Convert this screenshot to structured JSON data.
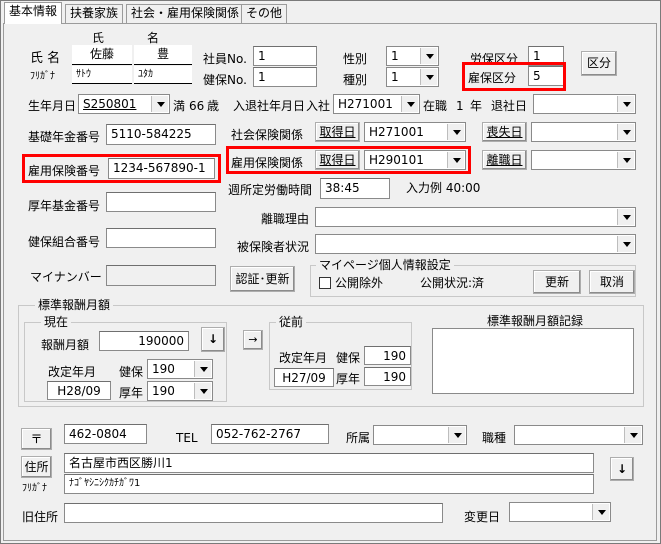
{
  "tabs": [
    "基本情報",
    "扶養家族",
    "社会・雇用保険関係",
    "その他"
  ],
  "name": {
    "label": "氏  名",
    "furigana_label": "ﾌﾘｶﾞﾅ",
    "header_last": "氏",
    "header_first": "名",
    "last": "佐藤",
    "first": "豊",
    "kana_last": "ｻﾄｳ",
    "kana_first": "ﾕﾀｶ"
  },
  "employee_no": {
    "label": "社員No.",
    "value": "1"
  },
  "health_no": {
    "label": "健保No.",
    "value": "1"
  },
  "gender": {
    "label": "性別",
    "value": "1"
  },
  "type": {
    "label": "種別",
    "value": "1"
  },
  "labor_insurance": {
    "label": "労保区分",
    "value": "1"
  },
  "employment_insurance": {
    "label": "雇保区分",
    "value": "5"
  },
  "category_button": "区分",
  "birth": {
    "label": "生年月日",
    "value": "S250801",
    "age_prefix": "満",
    "age": "66",
    "age_unit": "歳"
  },
  "join": {
    "label": "入退社年月日",
    "prefix": "入社",
    "value": "H271001",
    "status": "在職",
    "years": "1",
    "years_unit": "年",
    "retire_label": "退社日",
    "retire_value": ""
  },
  "pension_no": {
    "label": "基礎年金番号",
    "value": "5110-584225"
  },
  "social_insurance": {
    "label": "社会保険関係",
    "acquired_button": "取得日",
    "acquired": "H271001",
    "lost_button": "喪失日",
    "lost": ""
  },
  "employment_no": {
    "label": "雇用保険番号",
    "value": "1234-567890-1"
  },
  "employment_rel": {
    "label": "雇用保険関係",
    "acquired_button": "取得日",
    "acquired": "H290101",
    "left_button": "離職日",
    "left": ""
  },
  "weekly_hours": {
    "label": "週所定労働時間",
    "value": "38:45",
    "example": "入力例  40:00"
  },
  "pension_fund": {
    "label": "厚年基金番号",
    "value": ""
  },
  "separation_reason": {
    "label": "離職理由",
    "value": ""
  },
  "health_union": {
    "label": "健保組合番号",
    "value": ""
  },
  "insured_status": {
    "label": "被保険者状況",
    "value": ""
  },
  "my_number": {
    "label": "マイナンバー",
    "value": "",
    "auth_button": "認証･更新"
  },
  "mypage": {
    "title": "マイページ個人情報設定",
    "exclude_label": "公開除外",
    "status": "公開状況:済",
    "update_button": "更新",
    "cancel_button": "取消"
  },
  "standard_pay": {
    "title": "標準報酬月額",
    "current_title": "現在",
    "amount_label": "報酬月額",
    "amount": "190000",
    "revision_label": "改定年月",
    "revision": "H28/09",
    "health_label": "健保",
    "health": "190",
    "pension_label": "厚年",
    "pension": "190",
    "down_button": "↓",
    "copy_button": "→",
    "prev_title": "従前",
    "prev_revision_label": "改定年月",
    "prev_revision": "H27/09",
    "prev_health_label": "健保",
    "prev_health": "190",
    "prev_pension_label": "厚年",
    "prev_pension": "190",
    "record_title": "標準報酬月額記録"
  },
  "address": {
    "postal_button": "〒",
    "postal": "462-0804",
    "tel_label": "TEL",
    "tel": "052-762-2767",
    "dept_label": "所属",
    "dept": "",
    "job_label": "職種",
    "job": "",
    "address_button": "住所",
    "furigana_label": "ﾌﾘｶﾞﾅ",
    "address": "名古屋市西区勝川1",
    "address_kana": "ﾅｺﾞﾔｼﾆｼｸｶﾁｶﾞﾜ1",
    "down_button": "↓",
    "old_label": "旧住所",
    "old": "",
    "change_label": "変更日",
    "change": ""
  }
}
